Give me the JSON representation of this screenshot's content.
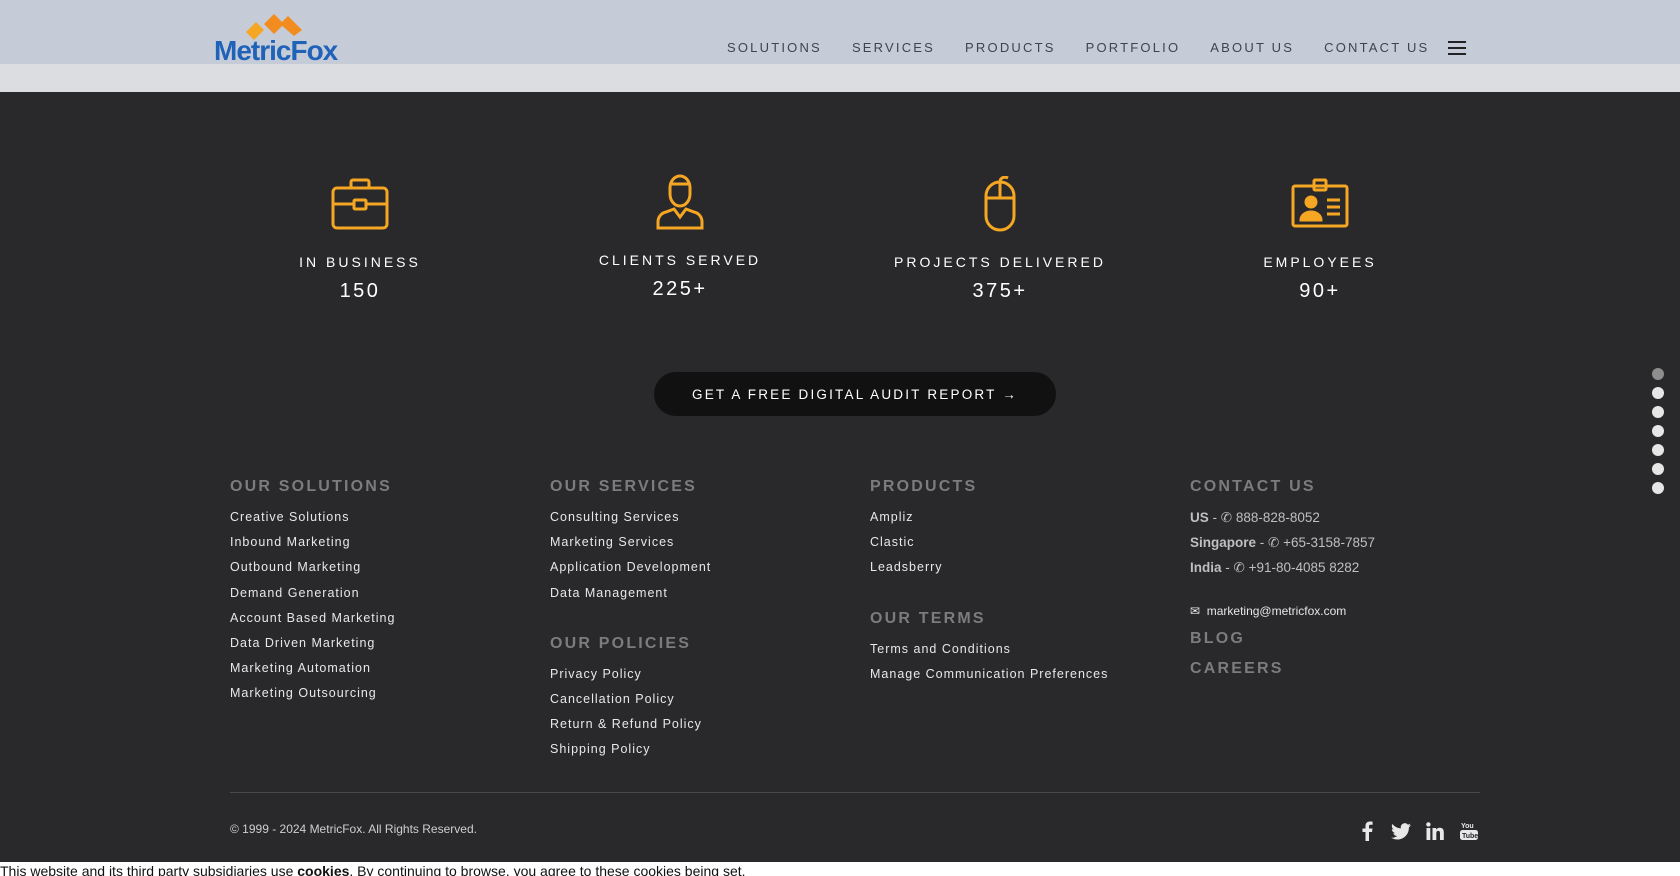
{
  "header": {
    "logo_text": "MetricFox",
    "nav": [
      "SOLUTIONS",
      "SERVICES",
      "PRODUCTS",
      "PORTFOLIO",
      "ABOUT US",
      "CONTACT US"
    ],
    "menu_icon": "hamburger-icon"
  },
  "stats": [
    {
      "icon": "briefcase-icon",
      "label": "IN BUSINESS",
      "value": "150"
    },
    {
      "icon": "person-icon",
      "label": "CLIENTS SERVED",
      "value": "225+"
    },
    {
      "icon": "mouse-icon",
      "label": "PROJECTS DELIVERED",
      "value": "375+"
    },
    {
      "icon": "id-card-icon",
      "label": "EMPLOYEES",
      "value": "90+"
    }
  ],
  "cta": {
    "label": "GET A FREE DIGITAL AUDIT REPORT →"
  },
  "colors": {
    "accent": "#f5a623",
    "background": "#29282b",
    "header_bg": "#c5ccd8",
    "logo_blue": "#1f62b8",
    "logo_orange": "#f28c1e"
  },
  "footer": {
    "solutions": {
      "title": "OUR SOLUTIONS",
      "items": [
        "Creative Solutions",
        "Inbound Marketing",
        "Outbound Marketing",
        "Demand Generation",
        "Account Based Marketing",
        "Data Driven Marketing",
        "Marketing Automation",
        "Marketing Outsourcing"
      ]
    },
    "services": {
      "title": "OUR SERVICES",
      "items": [
        "Consulting Services",
        "Marketing Services",
        "Application Development",
        "Data Management"
      ]
    },
    "policies": {
      "title": "OUR POLICIES",
      "items": [
        "Privacy Policy",
        "Cancellation Policy",
        "Return & Refund Policy",
        "Shipping Policy"
      ]
    },
    "products": {
      "title": "PRODUCTS",
      "items": [
        "Ampliz",
        "Clastic",
        "Leadsberry"
      ]
    },
    "terms": {
      "title": "OUR TERMS",
      "items": [
        "Terms and Conditions",
        "Manage Communication Preferences"
      ]
    },
    "contact": {
      "title": "CONTACT US",
      "lines": [
        {
          "country": "US",
          "sep": " - ",
          "phone": "888-828-8052"
        },
        {
          "country": "Singapore",
          "sep": " - ",
          "phone": "+65-3158-7857"
        },
        {
          "country": "India",
          "sep": " - ",
          "phone": "+91-80-4085 8282"
        }
      ],
      "email": "marketing@metricfox.com"
    },
    "blog": "BLOG",
    "careers": "CAREERS",
    "copyright": "© 1999 - 2024 MetricFox. All Rights Reserved.",
    "social": [
      "facebook-icon",
      "twitter-icon",
      "linkedin-icon",
      "youtube-icon"
    ]
  },
  "cookie": {
    "prefix": "This website and its third party subsidiaries use ",
    "bold": "cookies",
    "suffix": ". By continuing to browse, you agree to these cookies being set."
  }
}
